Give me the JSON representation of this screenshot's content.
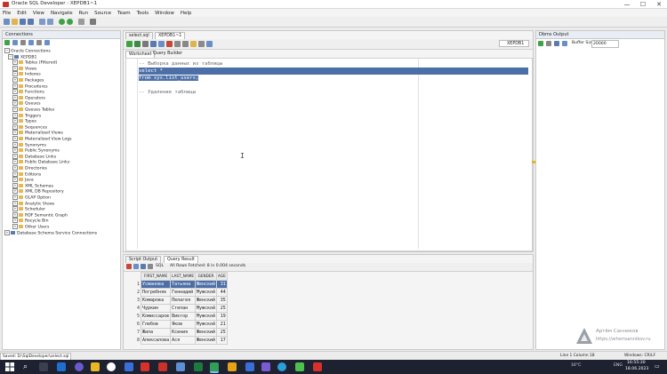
{
  "window": {
    "title": "Oracle SQL Developer : XEPDB1~1",
    "controls": [
      "—",
      "☐",
      "✕"
    ]
  },
  "menu": [
    "File",
    "Edit",
    "View",
    "Navigate",
    "Run",
    "Source",
    "Team",
    "Tools",
    "Window",
    "Help"
  ],
  "connections": {
    "title": "Connections",
    "root": "Oracle Connections",
    "connection": "XEPDB1",
    "items": [
      "Tables (Filtered)",
      "Views",
      "Indexes",
      "Packages",
      "Procedures",
      "Functions",
      "Operators",
      "Queues",
      "Queues Tables",
      "Triggers",
      "Types",
      "Sequences",
      "Materialized Views",
      "Materialized View Logs",
      "Synonyms",
      "Public Synonyms",
      "Database Links",
      "Public Database Links",
      "Directories",
      "Editions",
      "Java",
      "XML Schemas",
      "XML DB Repository",
      "OLAP Option",
      "Analytic Views",
      "Scheduler",
      "RDF Semantic Graph",
      "Recycle Bin",
      "Other Users"
    ],
    "footer": "Database Schema Service Connections"
  },
  "editor": {
    "tabs": [
      "select.sql",
      "XEPDB1~1"
    ],
    "subtabs": [
      "Worksheet",
      "Query Builder"
    ],
    "connection_label": "XEPDB1",
    "lines": [
      "-- Выборка данных из таблицы",
      "select *",
      "from sys.list_users;",
      "",
      "-- Удаление таблицы"
    ]
  },
  "dbms": {
    "title": "Dbms Output",
    "buffer_label": "Buffer Size:",
    "buffer_value": "20000"
  },
  "results": {
    "tabs": [
      "Script Output",
      "Query Result"
    ],
    "sql_label": "SQL",
    "status": "All Rows Fetched: 8 in 0.004 seconds",
    "columns": [
      "FIRST_NAME",
      "LAST_NAME",
      "GENDER",
      "AGE"
    ],
    "rows": [
      [
        "1",
        "Усманова",
        "Татьяна",
        "Женский",
        "31"
      ],
      [
        "2",
        "Погребняк",
        "Геннадий",
        "Мужской",
        "44"
      ],
      [
        "3",
        "Комарова",
        "Пелагея",
        "Женский",
        "35"
      ],
      [
        "4",
        "Чуркин",
        "Степан",
        "Мужской",
        "25"
      ],
      [
        "5",
        "Комиссаров",
        "Виктор",
        "Мужской",
        "19"
      ],
      [
        "6",
        "Глебов",
        "Яков",
        "Мужской",
        "21"
      ],
      [
        "7",
        "Жила",
        "Ксения",
        "Женский",
        "25"
      ],
      [
        "8",
        "Алексалова",
        "Ася",
        "Женский",
        "17"
      ]
    ]
  },
  "status": {
    "left": "Saved: D:\\SqlDeveloper\\select.sql",
    "line": "Line 1 Column 18",
    "mode": "Windows: CR/LF"
  },
  "watermark": {
    "name": "Артём Санников",
    "url": "https://artemsannikov.ru"
  },
  "taskbar": {
    "temp": "16°C",
    "lang": "ENG",
    "time": "16:55:30",
    "date": "18.06.2023"
  }
}
